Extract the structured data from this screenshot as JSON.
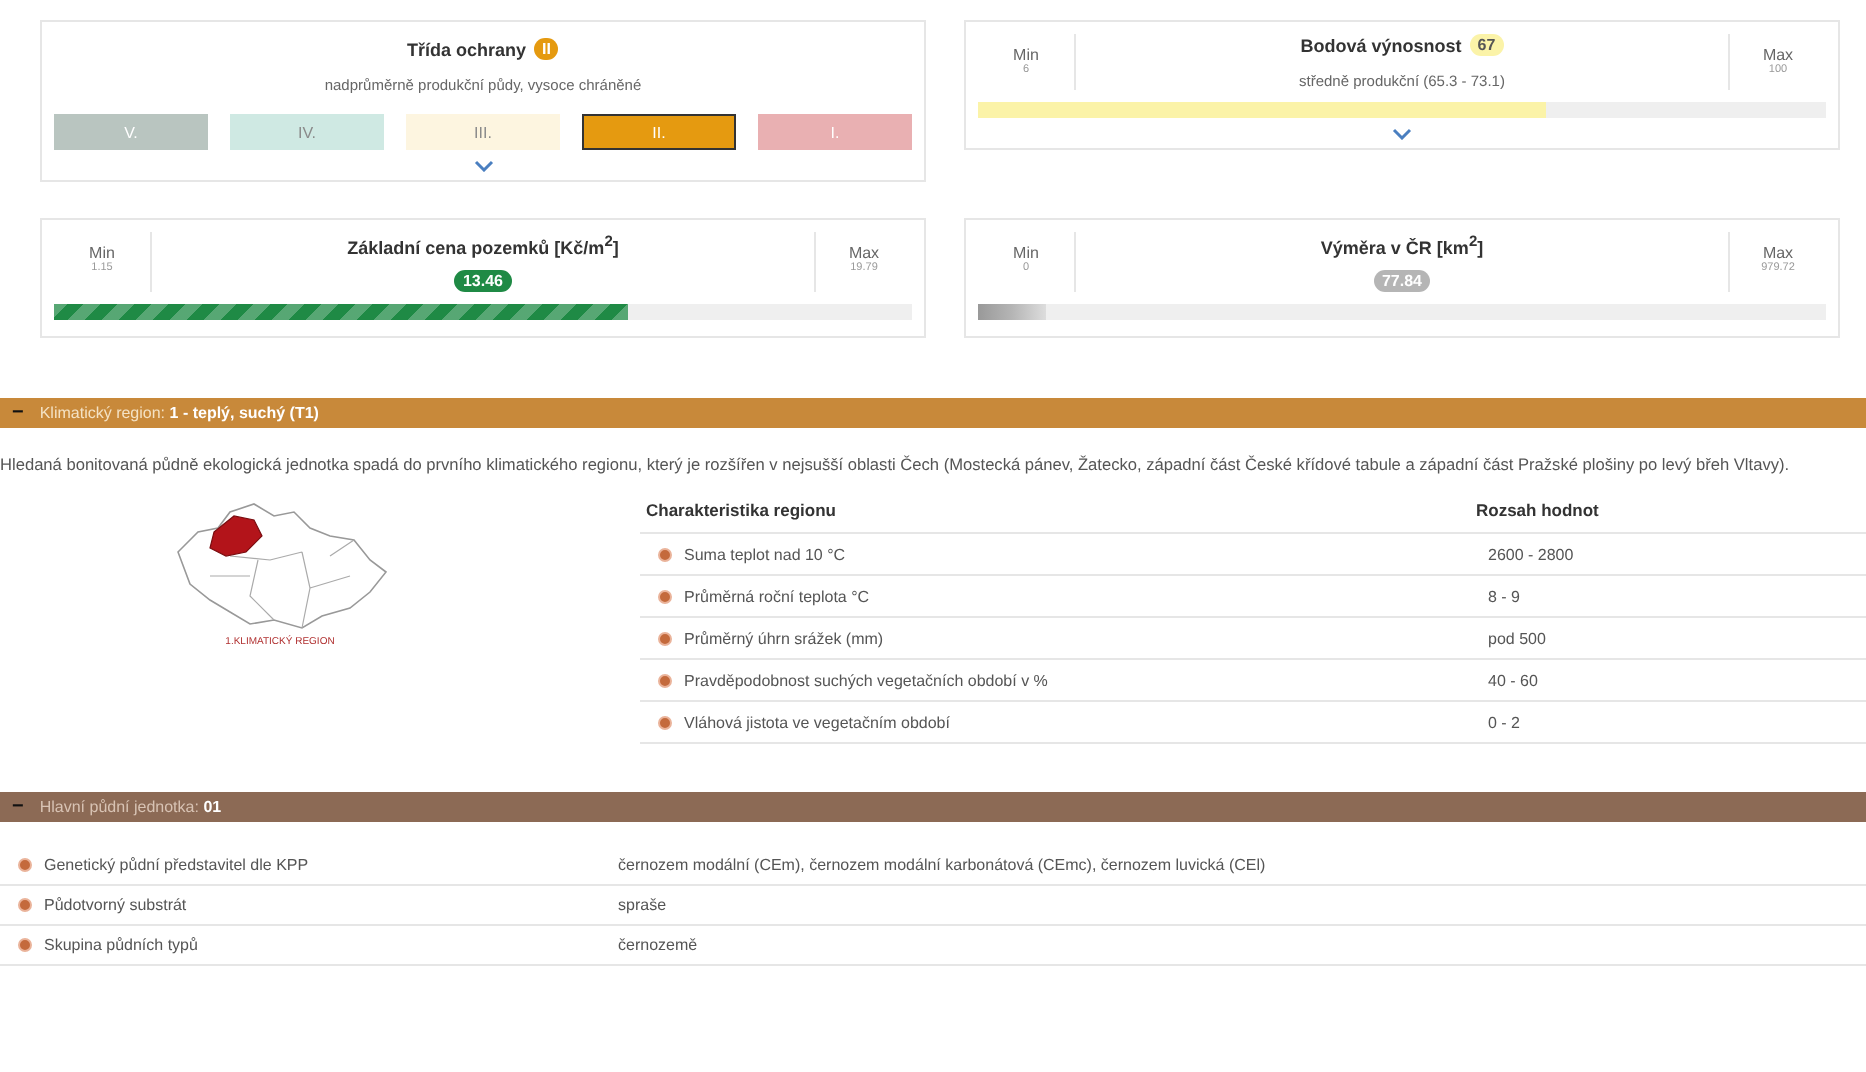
{
  "cards": [
    {
      "kind": "classes",
      "title": "Třída ochrany",
      "badge": "II",
      "color": "#e59a10",
      "subtitle": "nadprůměrně produkční půdy, vysoce chráněné",
      "expandable": true,
      "classes": [
        {
          "label": "V.",
          "color": "#b9c5c0",
          "selected": false
        },
        {
          "label": "IV.",
          "color": "#cfe9e3",
          "selected": false
        },
        {
          "label": "III.",
          "color": "#fdf5e0",
          "selected": false
        },
        {
          "label": "II.",
          "color": "#e59a10",
          "selected": true
        },
        {
          "label": "I.",
          "color": "#e9b0b2",
          "selected": false
        }
      ]
    },
    {
      "kind": "range",
      "title": "Bodová výnosnost",
      "badge": "67",
      "color": "#fbf3a8",
      "subtitle": "středně produkční (65.3 - 73.1)",
      "expandable": true,
      "min_label": "Min",
      "min": "6",
      "max_label": "Max",
      "max": "100",
      "level": 0.67,
      "striped": false
    },
    {
      "kind": "range",
      "title": "Základní cena pozemků [Kč/m$^{2}$]",
      "badge": "13.46",
      "color": "#1f8a45",
      "expandable": false,
      "min_label": "Min",
      "min": "1.15",
      "max_label": "Max",
      "max": "19.79",
      "level": 0.67,
      "striped": true
    },
    {
      "kind": "range",
      "title": "Výměra v ČR [km$^{2}$]",
      "badge": "77.84",
      "color": "#b5b5b5",
      "expandable": false,
      "min_label": "Min",
      "min": "0",
      "max_label": "Max",
      "max": "979.72",
      "level": 0.08,
      "striped": false
    }
  ],
  "climate": {
    "toggle": "−",
    "header": "Klimatický region: **1 - teplý, suchý (T1)**",
    "description": "Hledaná bonitovaná půdně ekologická jednotka spadá do prvního klimatického regionu, který je rozšířen v nejsušší oblasti Čech (Mostecká pánev, Žatecko, západní část České křídové tabule a západní část Pražské plošiny po levý břeh Vltavy).",
    "map_caption": "1.KLIMATICKÝ REGION",
    "columns": [
      "Charakteristika regionu",
      "Rozsah hodnot"
    ],
    "rows": [
      {
        "name": "Suma teplot nad 10 °C",
        "value": "2600 - 2800"
      },
      {
        "name": "Průměrná roční teplota °C",
        "value": "8 - 9"
      },
      {
        "name": "Průměrný úhrn srážek (mm)",
        "value": "pod 500"
      },
      {
        "name": "Pravděpodobnost suchých vegetačních období v %",
        "value": "40 - 60"
      },
      {
        "name": "Vláhová jistota ve vegetačním období",
        "value": "0 - 2"
      }
    ]
  },
  "soil_unit": {
    "toggle": "−",
    "header": "Hlavní půdní jednotka: **01**",
    "rows": [
      {
        "name": "Genetický půdní představitel dle KPP",
        "value": "černozem modální (CEm), černozem modální karbonátová (CEmc), černozem luvická (CEl)"
      },
      {
        "name": "Půdotvorný substrát",
        "value": "spraše"
      },
      {
        "name": "Skupina půdních typů",
        "value": "černozemě"
      }
    ]
  }
}
